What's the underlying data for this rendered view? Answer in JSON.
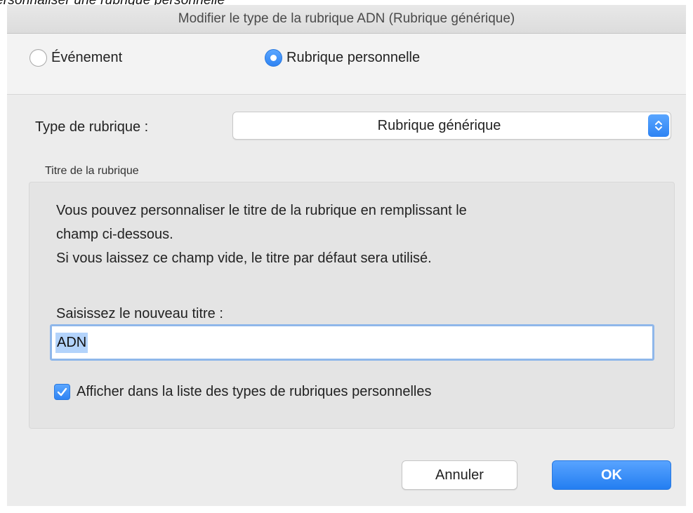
{
  "caption": "ersonnaliser une rubrique personnelle",
  "dialog": {
    "title": "Modifier le type de la rubrique ADN (Rubrique générique)",
    "accent_color": "#2e83f3"
  },
  "radios": {
    "evenement_label": "Événement",
    "evenement_selected": false,
    "rubrique_label": "Rubrique personnelle",
    "rubrique_selected": true
  },
  "type_field": {
    "label": "Type de rubrique :",
    "selected_value": "Rubrique générique",
    "icon": "chevron-updown-icon"
  },
  "group": {
    "label": "Titre de la rubrique",
    "info_line1": "Vous pouvez personnaliser le titre de la rubrique en remplissant le",
    "info_line2": "champ ci-dessous.",
    "info_line3": "Si vous laissez ce champ vide, le titre par défaut sera utilisé.",
    "prompt": "Saisissez le nouveau titre :",
    "input_value": "ADN",
    "checkbox_label": "Afficher dans la liste des types de rubriques personnelles",
    "checkbox_checked": true
  },
  "buttons": {
    "cancel_label": "Annuler",
    "ok_label": "OK"
  }
}
